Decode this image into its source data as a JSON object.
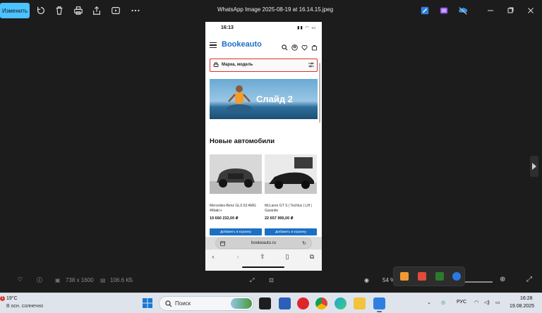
{
  "window": {
    "title": "WhatsApp Image 2025-08-19 at 16.14.15.jpeg",
    "edit_label": "Изменить"
  },
  "toolbar_icons": [
    "rotate-icon",
    "delete-icon",
    "print-icon",
    "share-icon",
    "slideshow-icon",
    "more-icon"
  ],
  "phone": {
    "status_time": "16:13",
    "site_logo": "Bookeauto",
    "search_placeholder": "Марка, модель",
    "banner_text": "Слайд 2",
    "section_title": "Новые автомобили",
    "cards": [
      {
        "name": "Mercedes-Benz GLS 63 AMG 4Matic+",
        "price": "19 660 232,00 ₽",
        "button": "Добавить в корзину"
      },
      {
        "name": "McLaren GT S | Techlux | Lift | Garantie",
        "price": "22 657 995,00 ₽",
        "button": "Добавить в корзину"
      }
    ],
    "url": "bookeauto.ru"
  },
  "infobar": {
    "resolution": "738 x 1600",
    "file_size": "106.6 КБ",
    "zoom": "54 %"
  },
  "taskbar": {
    "temperature": "19°C",
    "weather": "В осн. солнечно",
    "weather_badge": "1",
    "search_label": "Поиск",
    "language": "РУС",
    "time": "16:28",
    "date": "19.08.2025"
  },
  "colors": {
    "accent": "#4cc2ff",
    "brand_blue": "#1b70c4",
    "search_border": "#e0312b"
  }
}
